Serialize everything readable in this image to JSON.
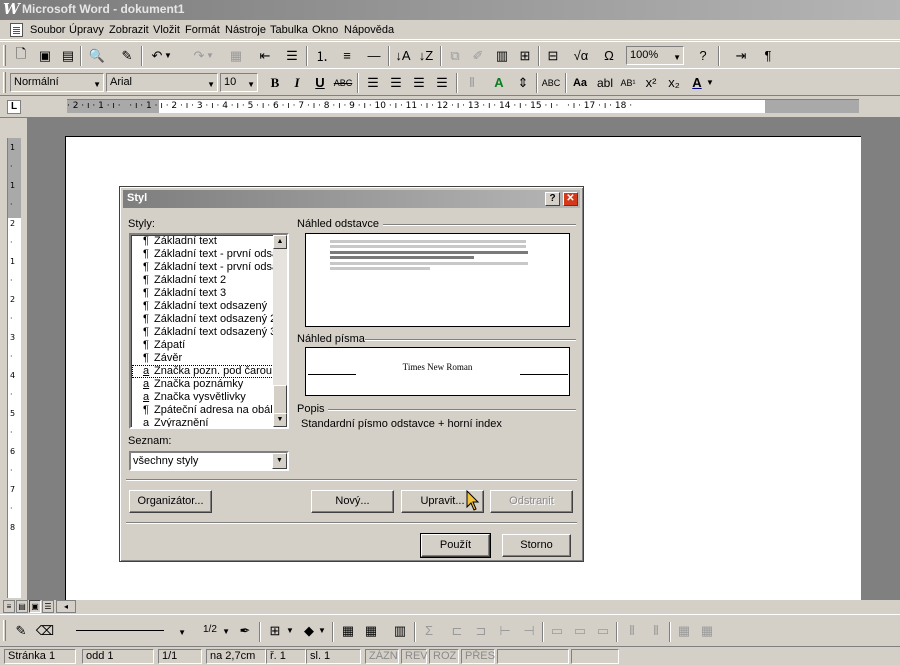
{
  "window": {
    "title": "Microsoft Word - dokument1"
  },
  "menu": [
    "Soubor",
    "Úpravy",
    "Zobrazit",
    "Vložit",
    "Formát",
    "Nástroje",
    "Tabulka",
    "Okno",
    "Nápověda"
  ],
  "formatting": {
    "style": "Normální",
    "font": "Arial",
    "size": "10",
    "zoom": "100%"
  },
  "ruler": {
    "marks": "· 2 · ı · 1 · ı ·   · ı · 1 · ı · 2 · ı · 3 · ı · 4 · ı · 5 · ı · 6 · ı · 7 · ı · 8 · ı · 9 · ı · 10 · ı · 11 · ı · 12 · ı · 13 · ı · 14 · ı · 15 · ı ·   · ı · 17 · ı · 18 ·"
  },
  "vruler": [
    "1",
    "·",
    "1",
    "·",
    "2",
    "·",
    "1",
    "·",
    "2",
    "·",
    "3",
    "·",
    "4",
    "·",
    "5",
    "·",
    "6",
    "·",
    "7",
    "·",
    "8"
  ],
  "dialog": {
    "title": "Styl",
    "styles_label": "Styly:",
    "styles": [
      {
        "sym": "¶",
        "name": "Základní text"
      },
      {
        "sym": "¶",
        "name": "Základní text - první odsa"
      },
      {
        "sym": "¶",
        "name": "Základní text - první odsa"
      },
      {
        "sym": "¶",
        "name": "Základní text 2"
      },
      {
        "sym": "¶",
        "name": "Základní text 3"
      },
      {
        "sym": "¶",
        "name": "Základní text odsazený"
      },
      {
        "sym": "¶",
        "name": "Základní text odsazený 2"
      },
      {
        "sym": "¶",
        "name": "Základní text odsazený 3"
      },
      {
        "sym": "¶",
        "name": "Zápatí"
      },
      {
        "sym": "¶",
        "name": "Závěr"
      },
      {
        "sym": "a",
        "name": "Značka pozn. pod čarou"
      },
      {
        "sym": "a",
        "name": "Značka poznámky"
      },
      {
        "sym": "a",
        "name": "Značka vysvětlivky"
      },
      {
        "sym": "¶",
        "name": "Zpáteční adresa na obálk"
      },
      {
        "sym": "a",
        "name": "Zvýraznění"
      }
    ],
    "selected_index": 10,
    "list_label": "Seznam:",
    "list_value": "všechny styly",
    "para_preview_label": "Náhled odstavce",
    "font_preview_label": "Náhled písma",
    "font_preview_text": "Times New Roman",
    "desc_label": "Popis",
    "desc_text": "Standardní písmo odstavce + horní index",
    "buttons": {
      "organizer": "Organizátor...",
      "new": "Nový...",
      "modify": "Upravit...",
      "delete": "Odstranit",
      "apply": "Použít",
      "cancel": "Storno"
    }
  },
  "drawbar": {
    "line_weight": "1/2"
  },
  "status": {
    "page": "Stránka 1",
    "section": "odd 1",
    "pages": "1/1",
    "position": "na 2,7cm",
    "line": "ř. 1",
    "column": "sl. 1",
    "rec": "ZÁZN",
    "rev": "REV",
    "ext": "ROZ",
    "ovr": "PŘES"
  }
}
